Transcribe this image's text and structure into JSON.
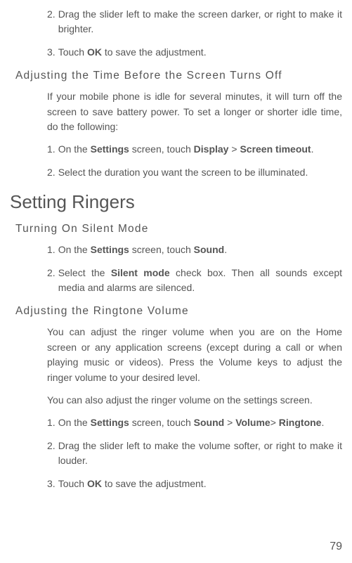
{
  "intro_steps": [
    {
      "num": "2.",
      "pre": "Drag the slider left to make the screen darker, or right to make it brighter."
    },
    {
      "num": "3.",
      "pre": "Touch ",
      "bold1": "OK",
      "post1": " to save the adjustment."
    }
  ],
  "screen_timeout": {
    "heading": "Adjusting the Time Before the Screen Turns Off",
    "para": "If your mobile phone is idle for several minutes, it will turn off the screen to save battery power. To set a longer or shorter idle time, do the following:",
    "steps": [
      {
        "num": "1.",
        "pre": "On the ",
        "bold1": "Settings",
        "mid1": " screen, touch ",
        "bold2": "Display",
        "mid2": " > ",
        "bold3": "Screen timeout",
        "post": "."
      },
      {
        "num": "2.",
        "pre": "Select the duration you want the screen to be illuminated."
      }
    ]
  },
  "ringers": {
    "heading": "Setting Ringers"
  },
  "silent": {
    "heading": "Turning On Silent Mode",
    "steps": [
      {
        "num": "1.",
        "pre": "On the ",
        "bold1": "Settings",
        "mid1": " screen, touch ",
        "bold2": "Sound",
        "post": "."
      },
      {
        "num": "2.",
        "pre": "Select the ",
        "bold1": "Silent mode",
        "post": " check box. Then all sounds except media and alarms are silenced."
      }
    ]
  },
  "ringtone": {
    "heading": "Adjusting the Ringtone Volume",
    "para1": "You can adjust the ringer volume when you are on the Home screen or any application screens (except during a call or when playing music or videos). Press the Volume keys to adjust the ringer volume to your desired level.",
    "para2": "You can also adjust the ringer volume on the settings screen.",
    "steps": [
      {
        "num": "1.",
        "pre": "On the ",
        "bold1": "Settings",
        "mid1": " screen, touch ",
        "bold2": "Sound",
        "mid2": " > ",
        "bold3": "Volume",
        "mid3": "> ",
        "bold4": "Ringtone",
        "post": "."
      },
      {
        "num": "2.",
        "pre": "Drag the slider left to make the volume softer, or right to make it louder."
      },
      {
        "num": "3.",
        "pre": "Touch ",
        "bold1": "OK",
        "post": " to save the adjustment."
      }
    ]
  },
  "page_number": "79"
}
